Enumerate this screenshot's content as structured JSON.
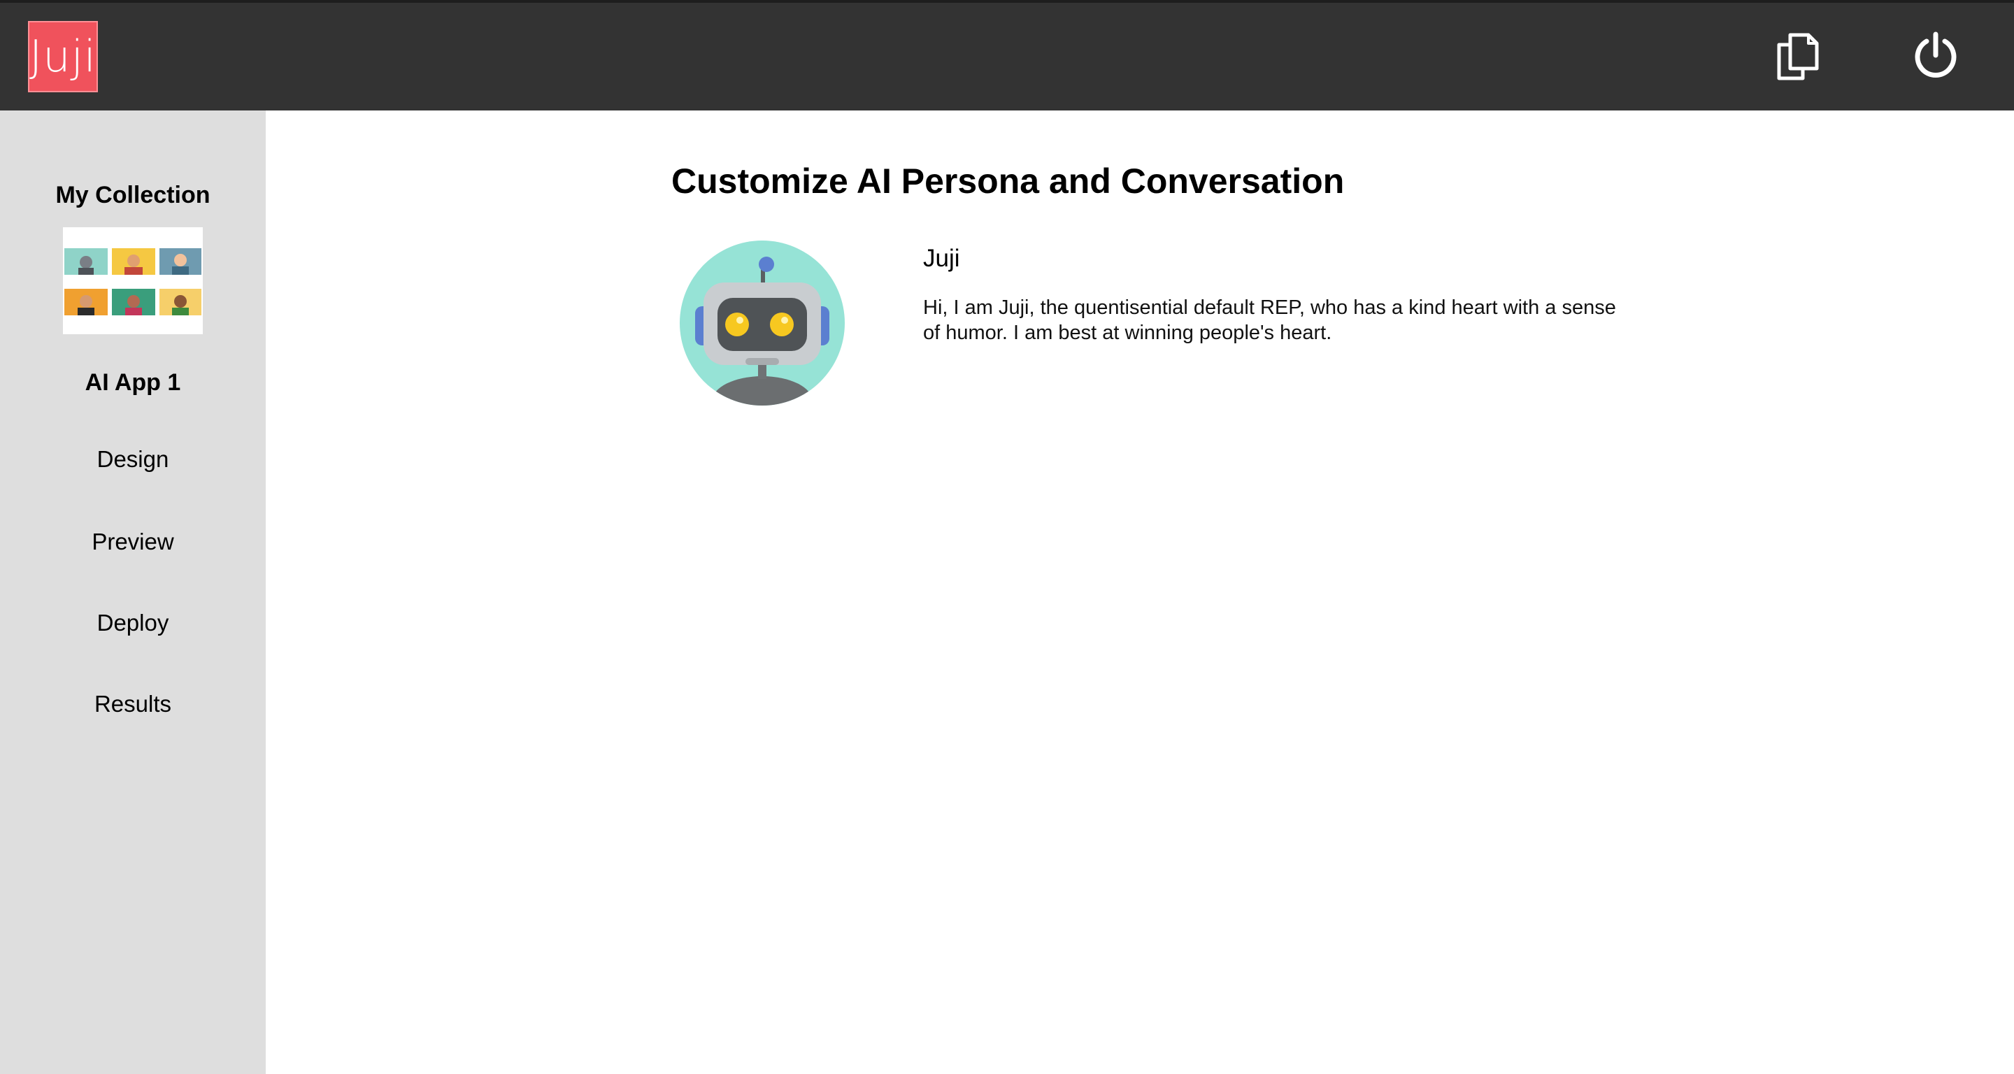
{
  "header": {
    "logo_text": "Juji",
    "copy_icon": "copy-icon",
    "power_icon": "power-icon",
    "colors": {
      "bar": "#333333",
      "logo_bg": "#f0525c"
    }
  },
  "sidebar": {
    "collection_title": "My Collection",
    "app_title": "AI App 1",
    "nav": [
      {
        "label": "Design"
      },
      {
        "label": "Preview"
      },
      {
        "label": "Deploy"
      },
      {
        "label": "Results"
      }
    ],
    "colors": {
      "bg": "#dedede"
    }
  },
  "main": {
    "title": "Customize AI Persona and Conversation",
    "persona": {
      "name": "Juji",
      "description": "Hi, I am Juji, the quentisential default REP, who has a kind heart with a sense of humor. I am best at winning people's heart.",
      "avatar_icon": "robot-avatar-icon"
    }
  }
}
